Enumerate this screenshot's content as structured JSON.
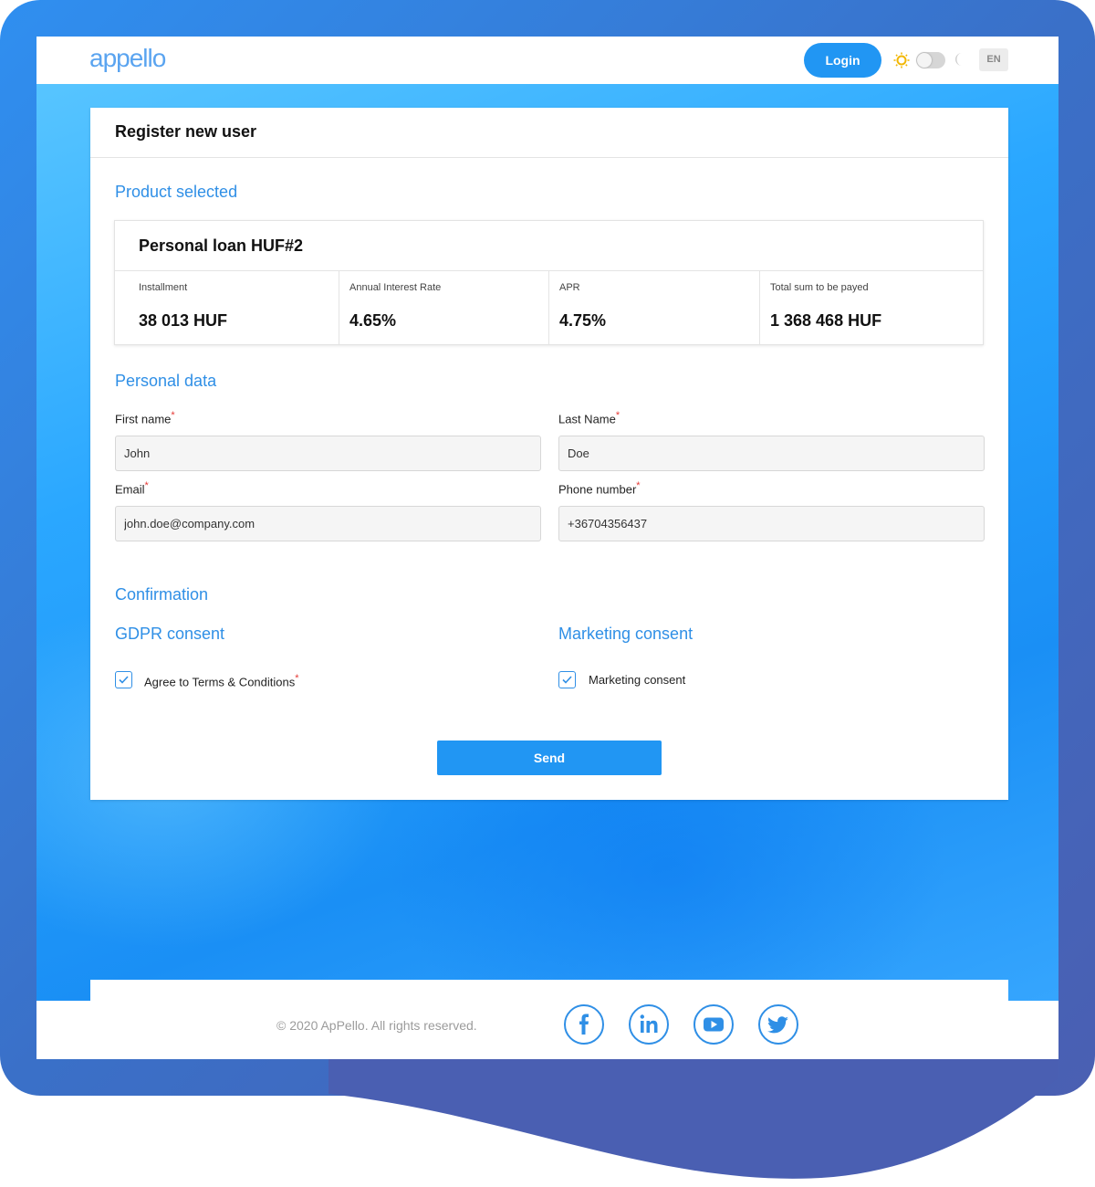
{
  "header": {
    "logo_text": "appello",
    "login_label": "Login",
    "language": "EN"
  },
  "form": {
    "title": "Register new user",
    "product_section": "Product selected",
    "product": {
      "name": "Personal loan HUF#2",
      "metrics": [
        {
          "label": "Installment",
          "value": "38 013 HUF"
        },
        {
          "label": "Annual Interest Rate",
          "value": "4.65%"
        },
        {
          "label": "APR",
          "value": "4.75%"
        },
        {
          "label": "Total sum to be payed",
          "value": "1 368 468 HUF"
        }
      ]
    },
    "personal_section": "Personal data",
    "fields": {
      "first_name": {
        "label": "First name",
        "value": "John"
      },
      "last_name": {
        "label": "Last Name",
        "value": "Doe"
      },
      "email": {
        "label": "Email",
        "value": "john.doe@company.com"
      },
      "phone": {
        "label": "Phone number",
        "value": "+36704356437"
      }
    },
    "required_mark": "*",
    "confirmation_section": "Confirmation",
    "gdpr": {
      "title": "GDPR consent",
      "label": "Agree to Terms & Conditions",
      "checked": true
    },
    "marketing": {
      "title": "Marketing consent",
      "label": "Marketing consent",
      "checked": true
    },
    "send_label": "Send"
  },
  "footer": {
    "copyright": "© 2020 ApPello. All rights reserved.",
    "social": [
      "facebook-icon",
      "linkedin-icon",
      "youtube-icon",
      "twitter-icon"
    ]
  },
  "colors": {
    "accent": "#2196f3",
    "section_title": "#2f8fe6",
    "required": "#e53935",
    "frame": "#3f6fc4"
  }
}
